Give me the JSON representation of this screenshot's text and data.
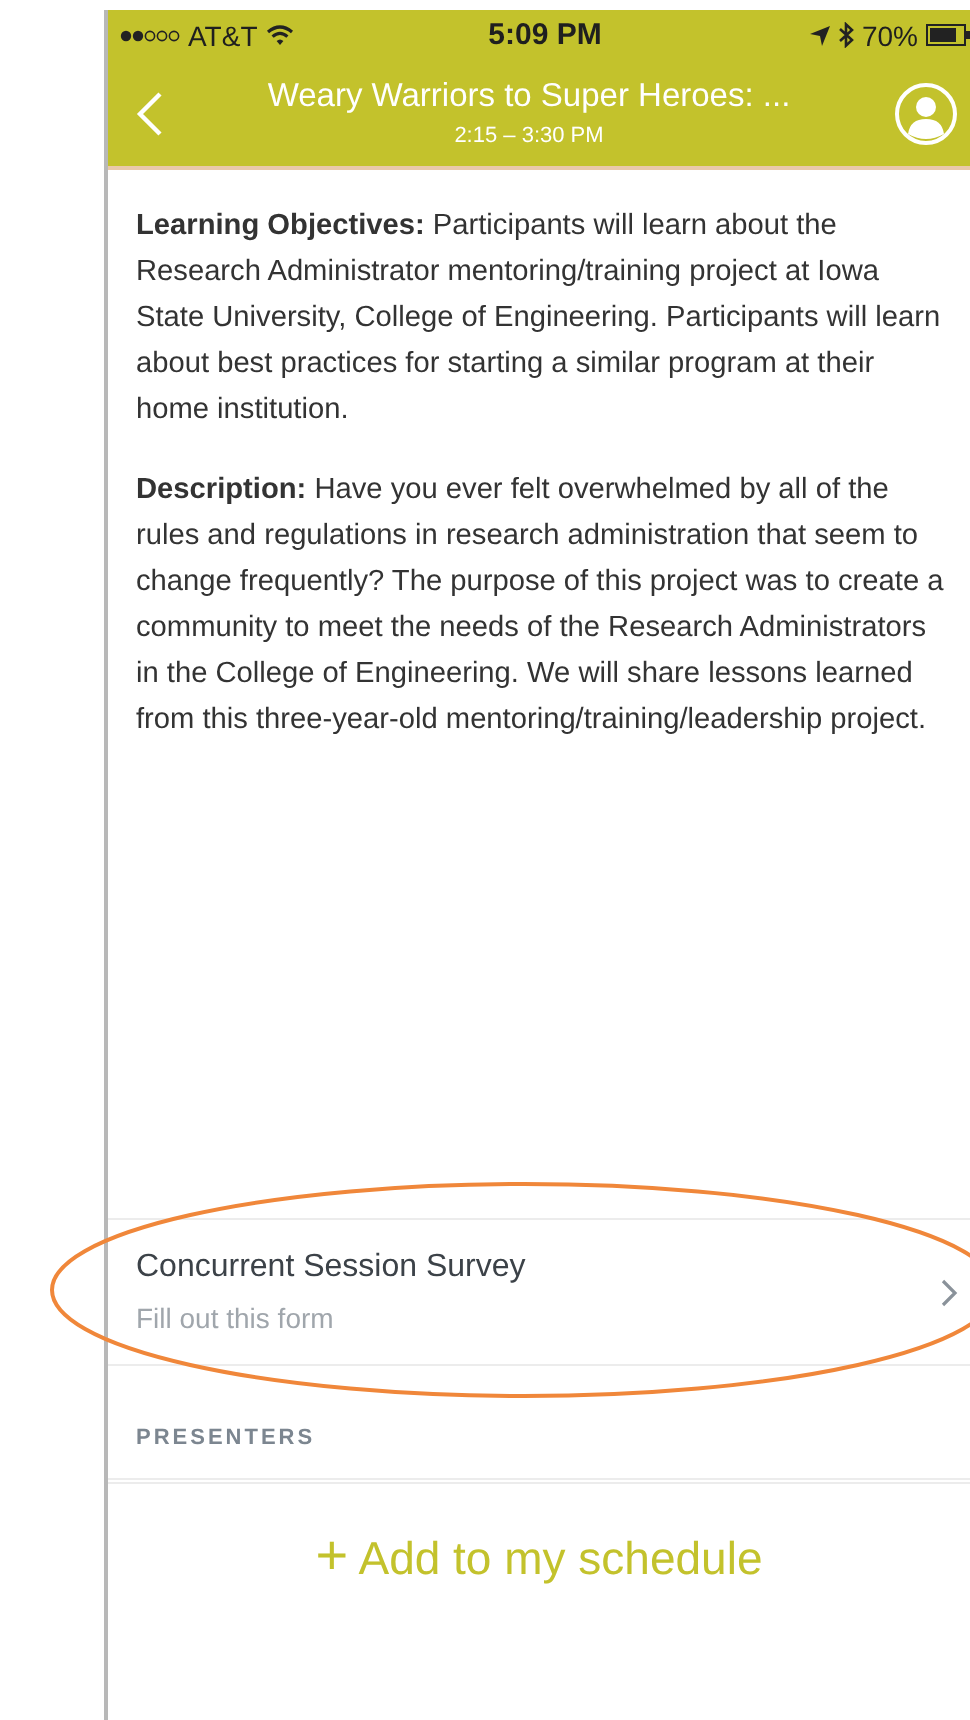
{
  "status_bar": {
    "carrier": "AT&T",
    "time": "5:09 PM",
    "battery": "70%"
  },
  "nav": {
    "title": "Weary Warriors to Super Heroes: ...",
    "subtitle": "2:15 – 3:30 PM"
  },
  "paragraphs": [
    "**Learning Objectives:**  Participants will learn about the Research Administrator mentoring/training project at Iowa State University, College of Engineering. Participants will learn about best practices for starting a similar program at their home institution.",
    "**Description:** Have you ever felt overwhelmed by all of the rules and regulations in research administration that seem to change frequently? The purpose of this project was to create a community to meet the needs of the Research Administrators in the College of Engineering. We will share lessons learned from this three-year-old mentoring/training/leadership project."
  ],
  "survey": {
    "title": "Concurrent Session Survey",
    "subtitle": "Fill out this form",
    "highlighted": true
  },
  "section_header": "PRESENTERS",
  "action": {
    "icon": "+",
    "label": "Add to my schedule"
  }
}
